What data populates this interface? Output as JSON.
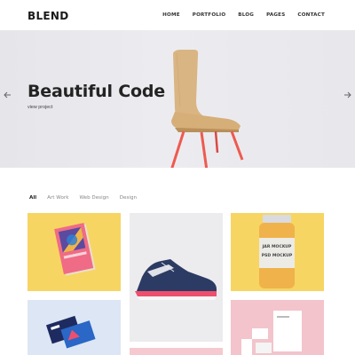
{
  "header": {
    "logo": "BLEND",
    "nav": [
      "HOME",
      "PORTFOLIO",
      "BLOG",
      "PAGES",
      "CONTACT"
    ]
  },
  "hero": {
    "title": "Beautiful Code",
    "link": "view project"
  },
  "filters": [
    "All",
    "Art Work",
    "Web Design",
    "Design"
  ],
  "jar_label": {
    "line1": "JAR MOCKUP",
    "line2": "PSD MOCKUP"
  },
  "icons": [
    "arrow-left-icon",
    "arrow-right-icon"
  ],
  "colors": {
    "yellow_tile": "#f7d562",
    "pink_tile": "#f3c4cb",
    "accent_pink": "#ee4f6f"
  }
}
